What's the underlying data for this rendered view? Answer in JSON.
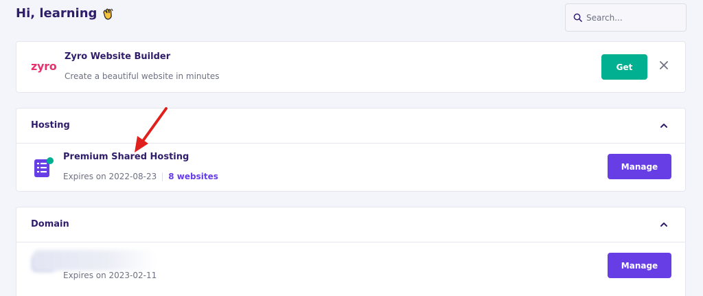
{
  "header": {
    "greeting": "Hi, learning"
  },
  "search": {
    "placeholder": "Search..."
  },
  "promo": {
    "logo_text": "zyro",
    "title": "Zyro Website Builder",
    "subtitle": "Create a beautiful website in minutes",
    "button_label": "Get"
  },
  "hosting": {
    "section_title": "Hosting",
    "item": {
      "title": "Premium Shared Hosting",
      "expires": "Expires on 2022-08-23",
      "websites": "8 websites",
      "button_label": "Manage"
    }
  },
  "domain": {
    "section_title": "Domain",
    "item": {
      "expires": "Expires on 2023-02-11",
      "button_label": "Manage"
    }
  },
  "colors": {
    "accent": "#673de6",
    "promo_button": "#00b090",
    "zyro_brand": "#e4336e",
    "heading": "#2f1c6a",
    "annotation_arrow": "#e0201c"
  },
  "icons": [
    "waving-hand-icon",
    "search-icon",
    "close-icon",
    "chevron-up-icon",
    "hosting-server-icon",
    "annotation-arrow"
  ]
}
